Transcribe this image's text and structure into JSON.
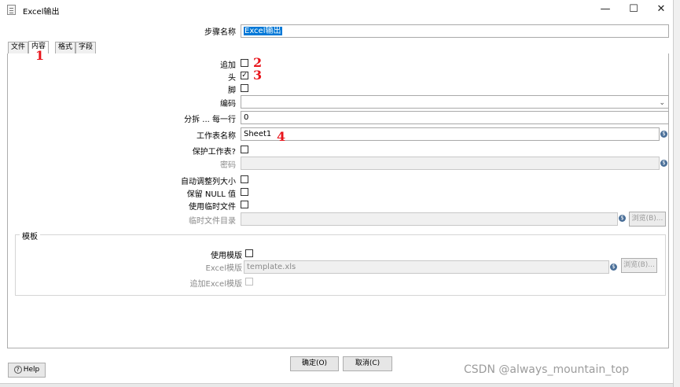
{
  "window": {
    "title": "Excel输出",
    "minimize": "—",
    "maximize": "☐",
    "close": "✕"
  },
  "step_name": {
    "label": "步骤名称",
    "value": "Excel输出"
  },
  "tabs": [
    {
      "label": "文件"
    },
    {
      "label": "内容"
    },
    {
      "label": "格式"
    },
    {
      "label": "字段"
    }
  ],
  "content": {
    "append": {
      "label": "追加",
      "checked": false
    },
    "header": {
      "label": "头",
      "checked": true
    },
    "footer": {
      "label": "脚",
      "checked": false
    },
    "encoding": {
      "label": "编码",
      "value": ""
    },
    "split": {
      "label": "分拆 ... 每一行",
      "value": "0"
    },
    "sheet_name": {
      "label": "工作表名称",
      "value": "Sheet1"
    },
    "protect_sheet": {
      "label": "保护工作表?",
      "checked": false
    },
    "password": {
      "label": "密码",
      "value": ""
    },
    "auto_size": {
      "label": "自动调整列大小",
      "checked": false
    },
    "retain_null": {
      "label": "保留 NULL 值",
      "checked": false
    },
    "use_temp": {
      "label": "使用临时文件",
      "checked": false
    },
    "temp_dir": {
      "label": "临时文件目录",
      "value": "",
      "browse": "浏览(B)..."
    }
  },
  "template": {
    "group_title": "模板",
    "use_template": {
      "label": "使用模版",
      "checked": false
    },
    "excel_template": {
      "label": "Excel模版",
      "value": "template.xls",
      "browse": "浏览(B)..."
    },
    "append_excel": {
      "label": "追加Excel模版",
      "checked": false
    }
  },
  "buttons": {
    "ok": "确定(O)",
    "cancel": "取消(C)",
    "help": "Help"
  },
  "annotations": [
    "1",
    "2",
    "3",
    "4"
  ],
  "watermark": "CSDN @always_mountain_top",
  "colors": {
    "annotation": "#e8141b",
    "selection": "#0078d7",
    "variable_icon": "#4a6f98"
  }
}
